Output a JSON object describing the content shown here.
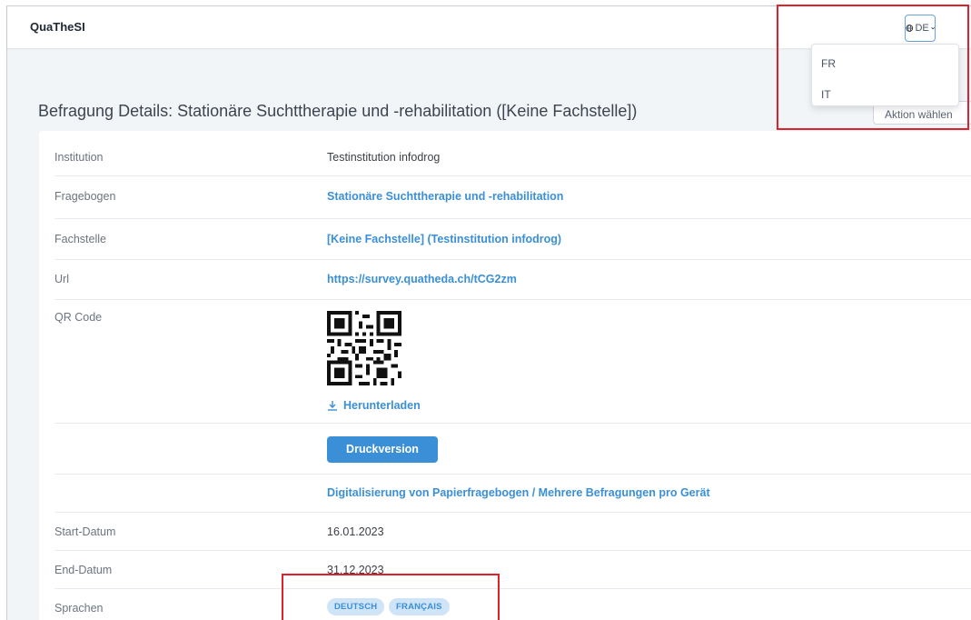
{
  "app": {
    "brand": "QuaTheSI"
  },
  "language": {
    "current": "DE",
    "options": [
      "FR",
      "IT"
    ]
  },
  "page": {
    "title": "Befragung Details: Stationäre Suchttherapie und -rehabilitation ([Keine Fachstelle])",
    "action_button": "Aktion wählen"
  },
  "details": {
    "institution_label": "Institution",
    "institution_value": "Testinstitution infodrog",
    "fragebogen_label": "Fragebogen",
    "fragebogen_value": "Stationäre Suchttherapie und -rehabilitation",
    "fachstelle_label": "Fachstelle",
    "fachstelle_value": "[Keine Fachstelle] (Testinstitution infodrog)",
    "url_label": "Url",
    "url_value": "https://survey.quatheda.ch/tCG2zm",
    "qr_label": "QR Code",
    "download_label": "Herunterladen",
    "print_button": "Druckversion",
    "digital_link": "Digitalisierung von Papierfragebogen / Mehrere Befragungen pro Gerät",
    "start_label": "Start-Datum",
    "start_value": "16.01.2023",
    "end_label": "End-Datum",
    "end_value": "31.12.2023",
    "languages_label": "Sprachen",
    "languages": [
      "DEUTSCH",
      "FRANÇAIS"
    ]
  },
  "colors": {
    "accent": "#3a8fd6",
    "highlight": "#e0202a",
    "background": "#f2f5f8"
  }
}
